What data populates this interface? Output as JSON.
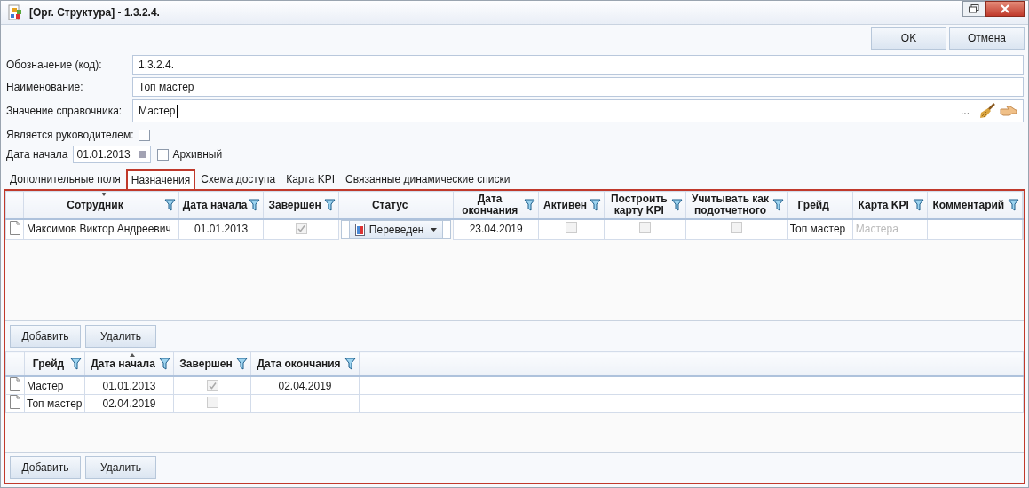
{
  "window": {
    "title": "[Орг. Структура] - 1.3.2.4."
  },
  "buttons": [
    {
      "label": "OK"
    },
    {
      "label": "Отмена"
    }
  ],
  "fields": [
    {
      "label": "Обозначение (код):",
      "value": "1.3.2.4.",
      "kind": "text"
    },
    {
      "label": "Наименование:",
      "value": "Топ мастер",
      "kind": "text"
    },
    {
      "label": "Значение справочника:",
      "value": "Мастер",
      "kind": "lookup",
      "ellipsis": "..."
    }
  ],
  "is_manager": {
    "label": "Является руководителем:",
    "checked": false
  },
  "start_date": {
    "label": "Дата начала",
    "value": "01.01.2013"
  },
  "archived": {
    "label": "Архивный",
    "checked": false
  },
  "tabs": [
    {
      "label": "Дополнительные поля",
      "selected": false
    },
    {
      "label": "Назначения",
      "selected": true
    },
    {
      "label": "Схема доступа",
      "selected": false
    },
    {
      "label": "Карта KPI",
      "selected": false
    },
    {
      "label": "Связанные динамические списки",
      "selected": false
    }
  ],
  "assignments": {
    "columns": [
      {
        "label": "Сотрудник",
        "kind": "text",
        "filter": true,
        "sorted_descending": true
      },
      {
        "label": "Дата начала",
        "kind": "date",
        "filter": true
      },
      {
        "label": "Завершен",
        "kind": "check",
        "filter": true
      },
      {
        "label": "Статус",
        "kind": "status",
        "filter": false
      },
      {
        "label": "Дата окончания",
        "kind": "date",
        "filter": true
      },
      {
        "label": "Активен",
        "kind": "check",
        "filter": true
      },
      {
        "label": "Построить карту KPI",
        "kind": "check",
        "filter": true
      },
      {
        "label": "Учитывать как подотчетного",
        "kind": "check",
        "filter": true
      },
      {
        "label": "Грейд",
        "kind": "text",
        "filter": false
      },
      {
        "label": "Карта KPI",
        "kind": "text",
        "filter": true
      },
      {
        "label": "Комментарий",
        "kind": "text",
        "filter": true
      }
    ],
    "rows": [
      {
        "cells": [
          {
            "text": "Максимов Виктор Андреевич"
          },
          {
            "text": "01.01.2013"
          },
          {
            "checked": true
          },
          {
            "text": "Переведен"
          },
          {
            "text": "23.04.2019"
          },
          {
            "checked": false
          },
          {
            "checked": false
          },
          {
            "checked": false
          },
          {
            "text": "Топ мастер"
          },
          {
            "text": "Мастера",
            "dimmed": true
          }
        ]
      }
    ],
    "buttons": [
      {
        "label": "Добавить"
      },
      {
        "label": "Удалить"
      }
    ]
  },
  "grades": {
    "columns": [
      {
        "label": "Грейд",
        "kind": "text",
        "filter": true
      },
      {
        "label": "Дата начала",
        "kind": "date",
        "filter": true,
        "sorted_ascending": true
      },
      {
        "label": "Завершен",
        "kind": "check",
        "filter": true
      },
      {
        "label": "Дата окончания",
        "kind": "date",
        "filter": true
      }
    ],
    "rows": [
      {
        "cells": [
          {
            "text": "Мастер"
          },
          {
            "text": "01.01.2013"
          },
          {
            "checked": true
          },
          {
            "text": "02.04.2019"
          }
        ]
      },
      {
        "cells": [
          {
            "text": "Топ мастер"
          },
          {
            "text": "02.04.2019"
          },
          {
            "checked": false
          }
        ]
      }
    ],
    "buttons": [
      {
        "label": "Добавить"
      },
      {
        "label": "Удалить"
      }
    ]
  }
}
